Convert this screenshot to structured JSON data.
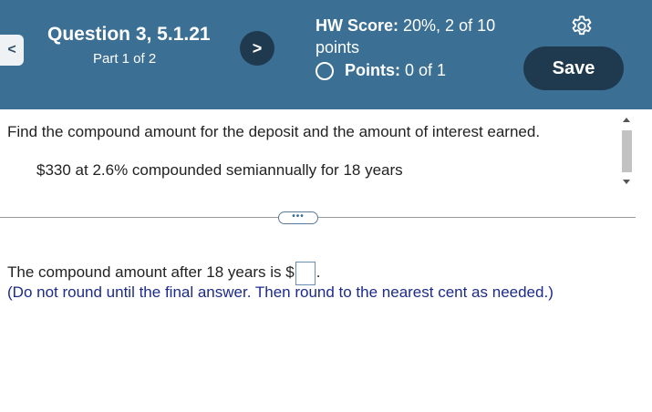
{
  "header": {
    "prev_icon": "chevron-left-icon",
    "prev_glyph": "<",
    "question_title": "Question 3, 5.1.21",
    "part_text": "Part 1 of 2",
    "next_icon": "chevron-right-icon",
    "next_glyph": ">",
    "hw_score_label": "HW Score:",
    "hw_score_value": "20%, 2 of 10 points",
    "points_label": "Points:",
    "points_value": "0 of 1",
    "settings_icon": "gear-icon",
    "save_label": "Save",
    "bg_color": "#3b6f93",
    "button_color": "#1f3a4f"
  },
  "question": {
    "prompt": "Find the compound amount for the deposit and the amount of interest earned.",
    "given": "$330 at 2.6% compounded semiannually for 18 years",
    "more_label": "•••"
  },
  "answer": {
    "prefix": "The compound amount after 18 years is $",
    "value": "",
    "suffix": ".",
    "note": "(Do not round until the final answer. Then round to the nearest cent as needed.)",
    "note_color": "#1c2b8a"
  }
}
